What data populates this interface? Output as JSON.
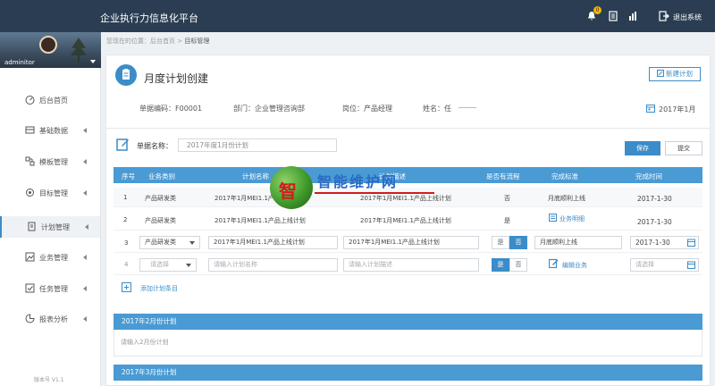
{
  "app": {
    "title": "企业执行力信息化平台",
    "notification_count": "0",
    "logout_label": "退出系统"
  },
  "sidebar": {
    "username": "adminitor",
    "items": [
      {
        "label": "后台首页",
        "icon": "dashboard-icon"
      },
      {
        "label": "基础数据",
        "icon": "archive-icon"
      },
      {
        "label": "模板管理",
        "icon": "template-icon"
      },
      {
        "label": "目标管理",
        "icon": "target-icon"
      },
      {
        "label": "计划管理",
        "icon": "document-icon"
      },
      {
        "label": "业务管理",
        "icon": "image-icon"
      },
      {
        "label": "任务管理",
        "icon": "task-icon"
      },
      {
        "label": "报表分析",
        "icon": "chart-icon"
      }
    ],
    "version": "版本号 V1.1"
  },
  "breadcrumb": {
    "prefix": "您现在的位置：后台首页",
    "sep": ">",
    "current": "目标管理"
  },
  "form": {
    "title": "月度计划创建",
    "new_plan_label": "新建计划",
    "doc_no": "单据编码：F00001",
    "department": "部门：企业管理咨询部",
    "position": "岗位：产品经理",
    "name": "姓名：任",
    "date": "2017年1月",
    "doc_name_label": "单据名称：",
    "doc_name_value": "2017年度1月份计划",
    "save_label": "保存",
    "submit_label": "提交"
  },
  "table": {
    "headers": [
      "序号",
      "业务类别",
      "计划名称",
      "计划描述",
      "是否有流程",
      "完成标准",
      "完成时间"
    ],
    "rows": [
      {
        "no": "1",
        "category": "产品研发类",
        "name": "2017年1月MEI1.1产品上线计划",
        "desc": "2017年1月MEI1.1产品上线计划",
        "flow": "否",
        "standard": "月底顺利上线",
        "date": "2017-1-30"
      },
      {
        "no": "2",
        "category": "产品研发类",
        "name": "2017年1月MEI1.1产品上线计划",
        "desc": "2017年1月MEI1.1产品上线计划",
        "flow": "是",
        "standard": "业务明细",
        "date": "2017-1-30"
      },
      {
        "no": "3",
        "category": "产品研发类",
        "name": "2017年1月MEI1.1产品上线计划",
        "desc": "2017年1月MEI1.1产品上线计划",
        "flow_yes": "是",
        "flow_no": "否",
        "standard": "月底顺利上线",
        "date": "2017-1-30"
      },
      {
        "no": "4",
        "category_placeholder": "请选择",
        "name_placeholder": "请输入计划名称",
        "desc_placeholder": "请输入计划描述",
        "flow_yes": "是",
        "flow_no": "否",
        "standard": "编辑业务",
        "date_placeholder": "请选择"
      }
    ],
    "add_label": "添加计划条目"
  },
  "sections": [
    {
      "title": "2017年2月份计划",
      "placeholder": "请输入2月份计划"
    },
    {
      "title": "2017年3月份计划"
    }
  ],
  "watermark": {
    "char": "智",
    "text": "智能维护网"
  },
  "colors": {
    "topbar": "#2b3d52",
    "accent": "#3b8cc8",
    "table_header": "#4a9ad4"
  }
}
